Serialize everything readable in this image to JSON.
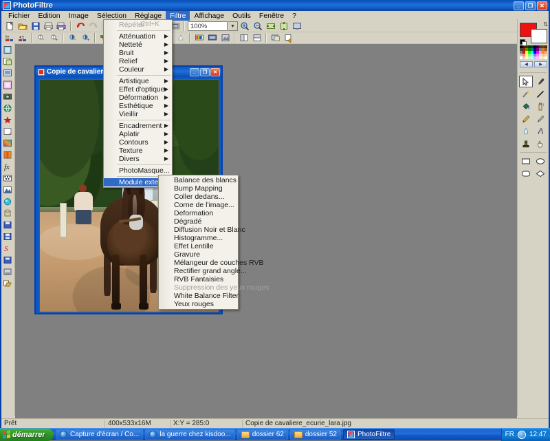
{
  "app": {
    "title": "PhotoFiltre",
    "icon": "photofiltre-icon",
    "window_buttons": {
      "minimize": "_",
      "restore": "❐",
      "close": "✕"
    }
  },
  "menubar": {
    "items": [
      {
        "label": "Fichier",
        "active": false
      },
      {
        "label": "Edition",
        "active": false
      },
      {
        "label": "Image",
        "active": false
      },
      {
        "label": "Sélection",
        "active": false
      },
      {
        "label": "Réglage",
        "active": false
      },
      {
        "label": "Filtre",
        "active": true
      },
      {
        "label": "Affichage",
        "active": false
      },
      {
        "label": "Outils",
        "active": false
      },
      {
        "label": "Fenêtre",
        "active": false
      },
      {
        "label": "?",
        "active": false
      }
    ]
  },
  "toolbar": {
    "zoom_value": "100%",
    "zoom_arrow": "▼",
    "row1_icons": [
      "new-document-icon",
      "open-folder-icon",
      "save-icon",
      "print-icon",
      "print-preview-icon",
      "undo-icon",
      "redo-icon",
      "copy-icon",
      "paste-icon",
      "text-tool-icon",
      "manage-icon",
      "palette-icon",
      "frame-icon",
      "zoom-in-icon",
      "zoom-out-icon",
      "fit-width-icon",
      "fit-height-icon",
      "full-screen-icon"
    ],
    "row2_icons": [
      "brightness-minus-icon",
      "brightness-plus-icon",
      "contrast-minus-icon",
      "contrast-plus-icon",
      "gamma-minus-icon",
      "gamma-plus-icon",
      "saturation-minus-icon",
      "saturation-plus-icon",
      "blur-icon",
      "blur2-icon",
      "sharpen-icon",
      "sharpen2-icon",
      "color-bars-icon",
      "screen-icon",
      "grayscale-icon",
      "flip-horizontal-icon",
      "flip-vertical-icon",
      "effects-icon",
      "export-icon"
    ]
  },
  "left_toolbar": {
    "icons": [
      "image-size-icon",
      "canvas-size-icon",
      "picture-frame-icon",
      "transparency-icon",
      "camera-icon",
      "web-icon",
      "star-icon",
      "page-curl-icon",
      "gradient-icon",
      "stripes-icon",
      "fx-icon",
      "mask-icon",
      "mountain-icon",
      "sphere-icon",
      "cylinder-icon",
      "save-as-icon",
      "save-all-icon",
      "red-script-icon",
      "save-copy-icon",
      "flatten-icon",
      "batch-icon"
    ]
  },
  "filter_menu": {
    "items": [
      {
        "label": "Répéter",
        "accel": "Ctrl+K",
        "disabled": true,
        "submenu": false,
        "separator_after": true
      },
      {
        "label": "Atténuation",
        "disabled": false,
        "submenu": true
      },
      {
        "label": "Netteté",
        "disabled": false,
        "submenu": true
      },
      {
        "label": "Bruit",
        "disabled": false,
        "submenu": true
      },
      {
        "label": "Relief",
        "disabled": false,
        "submenu": true
      },
      {
        "label": "Couleur",
        "disabled": false,
        "submenu": true,
        "separator_after": true
      },
      {
        "label": "Artistique",
        "disabled": false,
        "submenu": true
      },
      {
        "label": "Effet d'optique",
        "disabled": false,
        "submenu": true
      },
      {
        "label": "Déformation",
        "disabled": false,
        "submenu": true
      },
      {
        "label": "Esthétique",
        "disabled": false,
        "submenu": true
      },
      {
        "label": "Vieillir",
        "disabled": false,
        "submenu": true,
        "separator_after": true
      },
      {
        "label": "Encadrement",
        "disabled": false,
        "submenu": true
      },
      {
        "label": "Aplatir",
        "disabled": false,
        "submenu": true
      },
      {
        "label": "Contours",
        "disabled": false,
        "submenu": true
      },
      {
        "label": "Texture",
        "disabled": false,
        "submenu": true
      },
      {
        "label": "Divers",
        "disabled": false,
        "submenu": true,
        "separator_after": true
      },
      {
        "label": "PhotoMasque...",
        "disabled": false,
        "submenu": false,
        "separator_after": true
      },
      {
        "label": "Module externe",
        "disabled": false,
        "submenu": true,
        "highlighted": true
      }
    ]
  },
  "plugin_submenu": {
    "items": [
      {
        "label": "Balance des blancs",
        "disabled": false
      },
      {
        "label": "Bump Mapping",
        "disabled": false
      },
      {
        "label": "Coller dedans...",
        "disabled": false
      },
      {
        "label": "Corne de l'image...",
        "disabled": false
      },
      {
        "label": "Deformation",
        "disabled": false
      },
      {
        "label": "Dégradé",
        "disabled": false
      },
      {
        "label": "Diffusion Noir et Blanc",
        "disabled": false
      },
      {
        "label": "Histogramme...",
        "disabled": false
      },
      {
        "label": "Effet Lentille",
        "disabled": false
      },
      {
        "label": "Gravure",
        "disabled": false
      },
      {
        "label": "Mélangeur de couches RVB",
        "disabled": false
      },
      {
        "label": "Rectifier grand angle...",
        "disabled": false
      },
      {
        "label": "RVB Fantaisies",
        "disabled": false
      },
      {
        "label": "Suppression des yeux rouges",
        "disabled": true
      },
      {
        "label": "White Balance Filter",
        "disabled": false
      },
      {
        "label": "Yeux rouges",
        "disabled": false
      }
    ]
  },
  "document_window": {
    "title": "Copie de cavaliere_ecurie_lara.jpg",
    "icon": "image-document-icon",
    "buttons": {
      "minimize": "_",
      "maximize": "❐",
      "close": "✕"
    }
  },
  "statusbar": {
    "state": "Prêt",
    "dimensions": "400x533x16M",
    "coords": "X:Y = 285:0",
    "filename": "Copie de cavaliere_ecurie_lara.jpg"
  },
  "taskbar": {
    "start_label": "démarrer",
    "items": [
      {
        "label": "Capture d'écran / Co...",
        "icon": "internet-explorer-icon",
        "active": false
      },
      {
        "label": "la guerre chez kisdoo...",
        "icon": "internet-explorer-icon",
        "active": false
      },
      {
        "label": "dossier 62",
        "icon": "folder-icon",
        "active": false
      },
      {
        "label": "dossier 52",
        "icon": "folder-icon",
        "active": false
      },
      {
        "label": "PhotoFiltre",
        "icon": "photofiltre-icon",
        "active": true
      }
    ],
    "tray": {
      "language": "FR",
      "clock": "12:47",
      "clock_icon": "clock-icon"
    }
  },
  "palette": {
    "foreground_color": "#ee1111",
    "background_color": "#ffffff",
    "swap_icon": "swap-colors-icon",
    "default_icon": "default-colors-icon",
    "prev_label": "◀",
    "next_label": "▶",
    "swatch_colors": [
      "#000000",
      "#3a1a00",
      "#3a3a00",
      "#003a00",
      "#003a3a",
      "#00003a",
      "#3a003a",
      "#3a3a3a",
      "#7a3a00",
      "#5a2a00",
      "#404040",
      "#803000",
      "#808000",
      "#008000",
      "#008080",
      "#000080",
      "#800080",
      "#808080",
      "#c08040",
      "#a06030",
      "#808080",
      "#ff0000",
      "#ffff00",
      "#00ff00",
      "#00ffff",
      "#0000ff",
      "#ff00ff",
      "#c0c0c0",
      "#ff8040",
      "#ffa060",
      "#c0c0c0",
      "#ff8080",
      "#ffff80",
      "#80ff80",
      "#80ffff",
      "#8080ff",
      "#ff80ff",
      "#e0e0e0",
      "#ffc080",
      "#ffd0a0",
      "#ffffff",
      "#ffc0c0",
      "#ffffc0",
      "#c0ffc0",
      "#c0ffff",
      "#c0c0ff",
      "#ffc0ff",
      "#f0f0f0",
      "#ffe0c0",
      "#ffffff"
    ],
    "tools": [
      {
        "name": "selection-arrow-tool",
        "selected": true
      },
      {
        "name": "eyedropper-tool",
        "selected": false
      },
      {
        "name": "magic-wand-tool",
        "selected": false
      },
      {
        "name": "line-tool",
        "selected": false
      },
      {
        "name": "paint-bucket-tool",
        "selected": false
      },
      {
        "name": "spray-tool",
        "selected": false
      },
      {
        "name": "pencil-tool",
        "selected": false
      },
      {
        "name": "brush-tool",
        "selected": false
      },
      {
        "name": "water-drop-tool",
        "selected": false
      },
      {
        "name": "smudge-tool",
        "selected": false
      },
      {
        "name": "stamp-tool",
        "selected": false
      },
      {
        "name": "hand-tool",
        "selected": false
      },
      {
        "name": "rectangle-shape-tool",
        "selected": false
      },
      {
        "name": "ellipse-shape-tool",
        "selected": false
      },
      {
        "name": "rounded-rect-shape-tool",
        "selected": false
      },
      {
        "name": "diamond-shape-tool",
        "selected": false
      }
    ]
  }
}
